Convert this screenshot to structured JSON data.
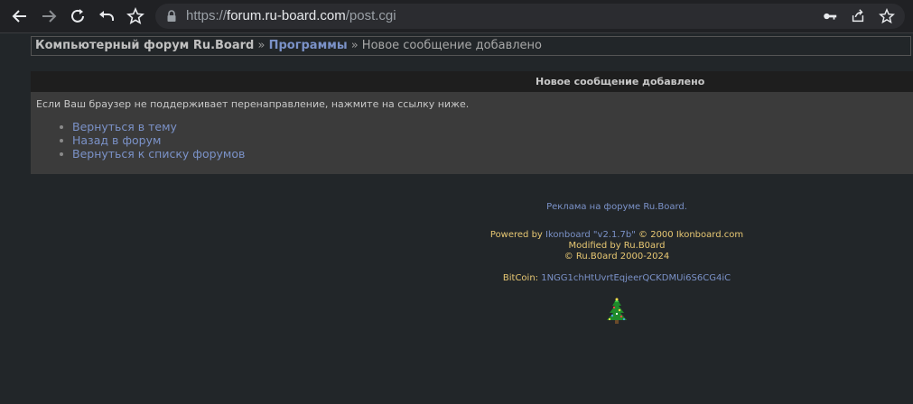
{
  "browser": {
    "url_scheme": "https://",
    "url_host": "forum.ru-board.com",
    "url_path": "/post.cgi"
  },
  "breadcrumb": {
    "forum": "Компьютерный форум Ru.Board",
    "sep1": " » ",
    "section": "Программы",
    "sep2": " » ",
    "current": "Новое сообщение добавлено"
  },
  "panel": {
    "title": "Новое сообщение добавлено",
    "message": "Если Ваш браузер не поддерживает перенаправление, нажмите на ссылку ниже.",
    "links": [
      "Вернуться в тему",
      "Назад в форум",
      "Вернуться к списку форумов"
    ]
  },
  "footer": {
    "ad": "Реклама на форуме Ru.Board.",
    "powered_prefix": "Powered by ",
    "powered_link": "Ikonboard \"v2.1.7b\"",
    "powered_suffix": " © 2000 Ikonboard.com",
    "modified": "Modified by Ru.B0ard",
    "copyright": "© Ru.B0ard 2000-2024",
    "bitcoin_label": "BitCoin: ",
    "bitcoin_address": "1NGG1chHtUvrtEqjeerQCKDMUi6S6CG4iC"
  },
  "colors": {
    "link": "#7b92c8",
    "footer_text": "#e8c873",
    "page_bg": "#222629",
    "panel_bg": "#3b3b3b"
  }
}
